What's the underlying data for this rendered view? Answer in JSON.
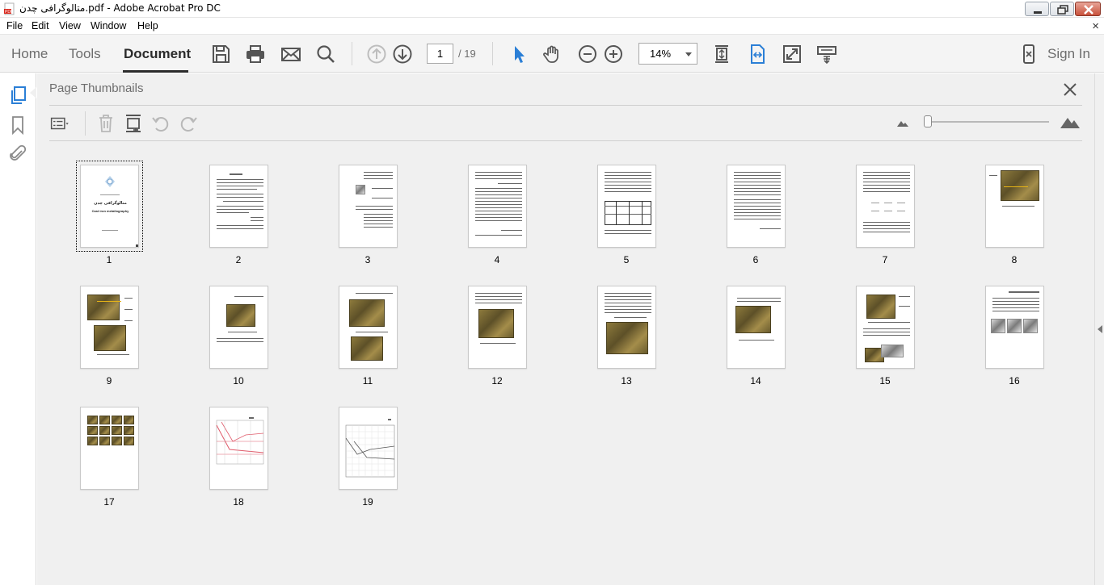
{
  "window": {
    "title": "متالوگرافی چدن.pdf - Adobe Acrobat Pro DC"
  },
  "menu": {
    "items": [
      "File",
      "Edit",
      "View",
      "Window",
      "Help"
    ],
    "close_glyph": "×"
  },
  "toolbar": {
    "tabs": {
      "home": "Home",
      "tools": "Tools",
      "document": "Document"
    },
    "active_tab": "Document",
    "icons": [
      "save-icon",
      "print-icon",
      "email-icon",
      "search-icon",
      "page-up-icon",
      "page-down-icon",
      "select-cursor-icon",
      "hand-icon",
      "zoom-out-icon",
      "zoom-in-icon",
      "fit-page-icon",
      "fit-width-icon",
      "fullscreen-icon",
      "read-mode-icon",
      "mobile-icon"
    ],
    "current_page": "1",
    "page_total": "/ 19",
    "zoom": "14%",
    "sign_in": "Sign In"
  },
  "panel": {
    "title": "Page Thumbnails",
    "icons": [
      "options-menu-icon",
      "delete-icon",
      "insert-page-icon",
      "rotate-ccw-icon",
      "rotate-cw-icon",
      "small-mountain-icon",
      "large-mountain-icon"
    ],
    "thumbnail_size": 0.0
  },
  "rail": {
    "icons": [
      "page-thumbnails-icon",
      "bookmark-icon",
      "attachment-icon"
    ]
  },
  "thumbnails": {
    "selected_page": 1,
    "pages": [
      {
        "label": "1"
      },
      {
        "label": "2"
      },
      {
        "label": "3"
      },
      {
        "label": "4"
      },
      {
        "label": "5"
      },
      {
        "label": "6"
      },
      {
        "label": "7"
      },
      {
        "label": "8"
      },
      {
        "label": "9"
      },
      {
        "label": "10"
      },
      {
        "label": "11"
      },
      {
        "label": "12"
      },
      {
        "label": "13"
      },
      {
        "label": "14"
      },
      {
        "label": "15"
      },
      {
        "label": "16"
      },
      {
        "label": "17"
      },
      {
        "label": "18"
      },
      {
        "label": "19"
      }
    ],
    "cover": {
      "title": "متالوگرافی چدن",
      "subtitle": "Cast iron metallography"
    }
  },
  "colors": {
    "accent_blue": "#2b7fd6",
    "active_tab_text": "#2b2b2b",
    "inactive_text": "#6d6d6d",
    "panel_bg": "#f0f0f0"
  }
}
